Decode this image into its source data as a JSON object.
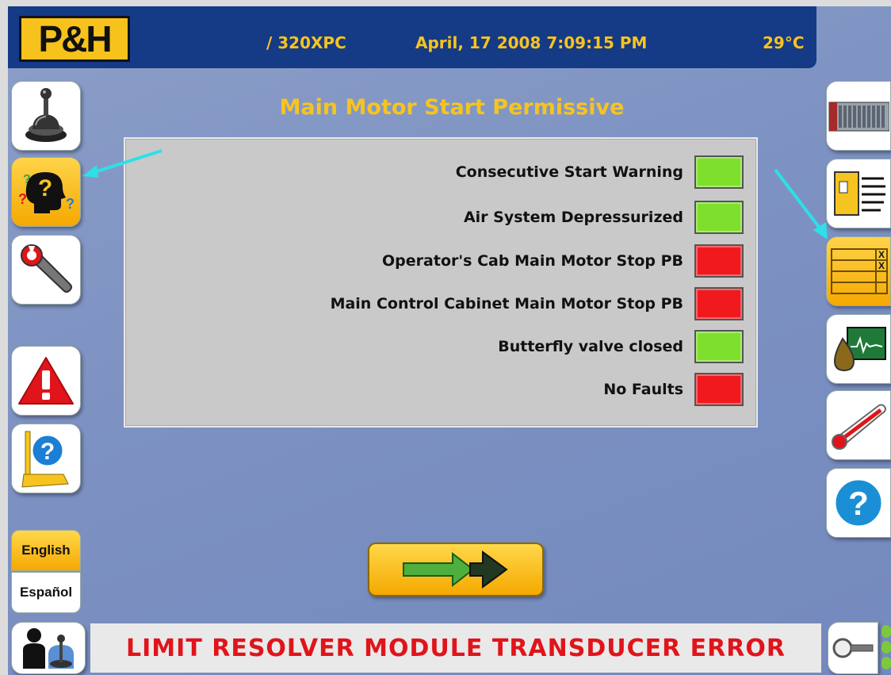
{
  "header": {
    "logo_text": "P&H",
    "machine": "/ 320XPC",
    "datetime": "April, 17 2008 7:09:15 PM",
    "temperature": "29°C"
  },
  "page_title": "Main Motor Start Permissive",
  "permissives": [
    {
      "label": "Consecutive Start Warning",
      "status": "green"
    },
    {
      "label": "Air System Depressurized",
      "status": "green"
    },
    {
      "label": "Operator's Cab Main Motor Stop PB",
      "status": "red"
    },
    {
      "label": "Main Control Cabinet Main Motor Stop PB",
      "status": "red"
    },
    {
      "label": "Butterfly valve closed",
      "status": "green"
    },
    {
      "label": "No Faults",
      "status": "red"
    }
  ],
  "language": {
    "english": "English",
    "spanish": "Español",
    "selected": "English"
  },
  "status_message": "LIMIT RESOLVER MODULE TRANSDUCER ERROR",
  "colors": {
    "header_bg": "#153a86",
    "accent_yellow": "#f6c420",
    "background": "#7d92c2",
    "indicator_green": "#7ee02c",
    "indicator_red": "#f0191e",
    "status_text": "#e0141a",
    "annotation_arrow": "#2ee0e8"
  },
  "icons": {
    "left": [
      "joystick-icon",
      "help-head-icon",
      "wrench-icon",
      "warning-icon",
      "machine-help-icon"
    ],
    "right": [
      "plc-rack-icon",
      "cabinet-list-icon",
      "fault-table-icon",
      "oil-trend-icon",
      "thermometer-icon",
      "question-icon"
    ]
  }
}
